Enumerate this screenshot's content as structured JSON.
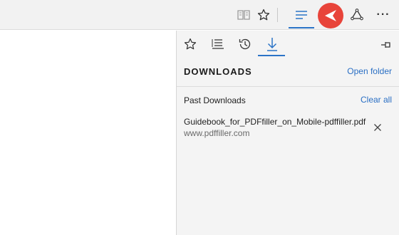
{
  "toolbar": {
    "icons": [
      "reading-view-icon",
      "favorite-star-icon",
      "hub-icon",
      "web-note-icon",
      "share-icon",
      "more-icon"
    ],
    "more_label": "···"
  },
  "hub": {
    "tabs": [
      "favorites",
      "reading-list",
      "history",
      "downloads"
    ],
    "active_tab": "downloads",
    "title": "DOWNLOADS",
    "open_folder": "Open folder",
    "past_downloads": "Past Downloads",
    "clear_all": "Clear all",
    "downloads": [
      {
        "filename": "Guidebook_for_PDFfiller_on_Mobile-pdffiller.pdf",
        "source": "www.pdffiller.com"
      }
    ]
  },
  "colors": {
    "accent": "#2b74c7",
    "link": "#2a6fc4",
    "highlight_circle": "#e8443a",
    "toolbar_bg": "#f2f2f2",
    "panel_bg": "#f4f4f4"
  }
}
